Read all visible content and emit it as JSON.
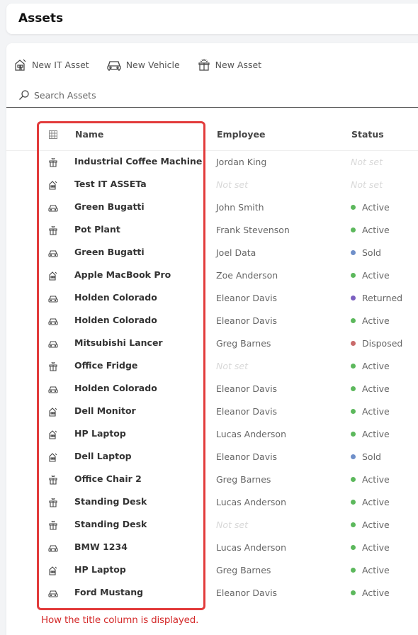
{
  "header": {
    "title": "Assets"
  },
  "toolbar": {
    "new_it_asset": "New IT Asset",
    "new_vehicle": "New Vehicle",
    "new_asset": "New Asset"
  },
  "search": {
    "placeholder": "Search Assets"
  },
  "columns": {
    "name": "Name",
    "employee": "Employee",
    "status": "Status"
  },
  "status_colors": {
    "Active": "#5cb85c",
    "Sold": "#6f8fc9",
    "Returned": "#7b5fc0",
    "Disposed": "#c96a6a"
  },
  "not_set_label": "Not set",
  "rows": [
    {
      "type": "asset",
      "name": "Industrial Coffee Machine",
      "employee": "Jordan King",
      "status": "Not set"
    },
    {
      "type": "it",
      "name": "Test IT ASSETa",
      "employee": "Not set",
      "status": "Not set"
    },
    {
      "type": "vehicle",
      "name": "Green Bugatti",
      "employee": "John Smith",
      "status": "Active"
    },
    {
      "type": "asset",
      "name": "Pot Plant",
      "employee": "Frank Stevenson",
      "status": "Active"
    },
    {
      "type": "vehicle",
      "name": "Green Bugatti",
      "employee": "Joel Data",
      "status": "Sold"
    },
    {
      "type": "it",
      "name": "Apple MacBook Pro",
      "employee": "Zoe Anderson",
      "status": "Active"
    },
    {
      "type": "vehicle",
      "name": "Holden Colorado",
      "employee": "Eleanor Davis",
      "status": "Returned"
    },
    {
      "type": "vehicle",
      "name": "Holden Colorado",
      "employee": "Eleanor Davis",
      "status": "Active"
    },
    {
      "type": "vehicle",
      "name": "Mitsubishi Lancer",
      "employee": "Greg Barnes",
      "status": "Disposed"
    },
    {
      "type": "asset",
      "name": "Office Fridge",
      "employee": "Not set",
      "status": "Active"
    },
    {
      "type": "vehicle",
      "name": "Holden Colorado",
      "employee": "Eleanor Davis",
      "status": "Active"
    },
    {
      "type": "it",
      "name": "Dell Monitor",
      "employee": "Eleanor Davis",
      "status": "Active"
    },
    {
      "type": "it",
      "name": "HP Laptop",
      "employee": "Lucas Anderson",
      "status": "Active"
    },
    {
      "type": "it",
      "name": "Dell Laptop",
      "employee": "Eleanor Davis",
      "status": "Sold"
    },
    {
      "type": "asset",
      "name": "Office Chair 2",
      "employee": "Greg Barnes",
      "status": "Active"
    },
    {
      "type": "asset",
      "name": "Standing Desk",
      "employee": "Lucas Anderson",
      "status": "Active"
    },
    {
      "type": "asset",
      "name": "Standing Desk",
      "employee": "Not set",
      "status": "Active"
    },
    {
      "type": "vehicle",
      "name": "BMW 1234",
      "employee": "Lucas Anderson",
      "status": "Active"
    },
    {
      "type": "it",
      "name": "HP Laptop",
      "employee": "Greg Barnes",
      "status": "Active"
    },
    {
      "type": "vehicle",
      "name": "Ford Mustang",
      "employee": "Eleanor Davis",
      "status": "Active"
    }
  ],
  "annotation": {
    "caption": "How the title column is displayed."
  }
}
